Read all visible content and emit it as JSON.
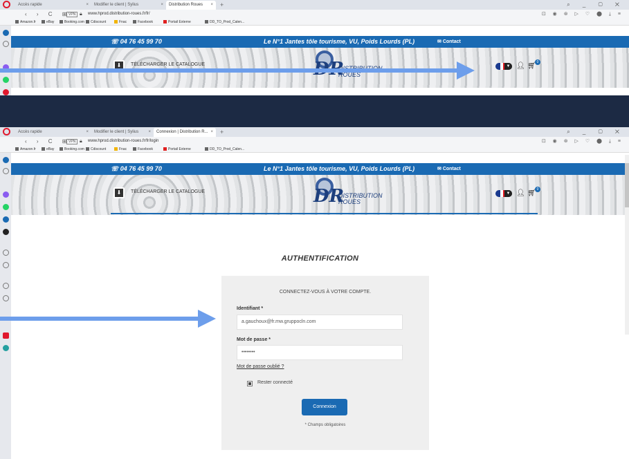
{
  "screenshot1": {
    "tabs": [
      {
        "label": "Accès rapide"
      },
      {
        "label": "Modifier le client | Sylius"
      },
      {
        "label": "Distribution Roues"
      }
    ],
    "url": "www.hprod.distribution-roues.fr/fr/"
  },
  "screenshot2": {
    "tabs": [
      {
        "label": "Accès rapide"
      },
      {
        "label": "Modifier le client | Sylius"
      },
      {
        "label": "Connexion | Distribution R..."
      }
    ],
    "url": "www.hprod.distribution-roues.fr/fr/login"
  },
  "browser": {
    "vpn_label": "VPN",
    "new_tab": "+",
    "bookmarks": [
      "Amazon.fr",
      "eBay",
      "Booking.com",
      "Cdiscount",
      "Fnac",
      "Facebook",
      "Portail Externe",
      "DD_TO_Prod_Calen..."
    ]
  },
  "site": {
    "phone": "04 76 45 99 70",
    "tagline": "Le N°1 Jantes tôle tourisme, VU, Poids Lourds (PL)",
    "contact": "Contact",
    "catalogue": "TÉLÉCHARGER LE CATALOGUE",
    "logo_dr": "DR",
    "logo_line1": "DISTRIBUTION",
    "logo_line2": "ROUES",
    "cart_count": "0"
  },
  "login": {
    "page_title": "AUTHENTIFICATION",
    "card_title": "CONNECTEZ-VOUS À VOTRE COMPTE.",
    "identifiant_label": "Identifiant *",
    "identifiant_value": "a.gauchoux@fr.mw.gruppocln.com",
    "password_label": "Mot de passe *",
    "password_value": "••••••••",
    "forgot_link": "Mot de passe oublié ?",
    "remember_label": "Rester connecté",
    "remember_checked": true,
    "submit_label": "Connexion",
    "required_note": "* Champs obligatoires"
  },
  "colors": {
    "brand_blue": "#1a6ab3",
    "annotation_arrow": "#6d9eeb",
    "background": "#1c2a44"
  }
}
